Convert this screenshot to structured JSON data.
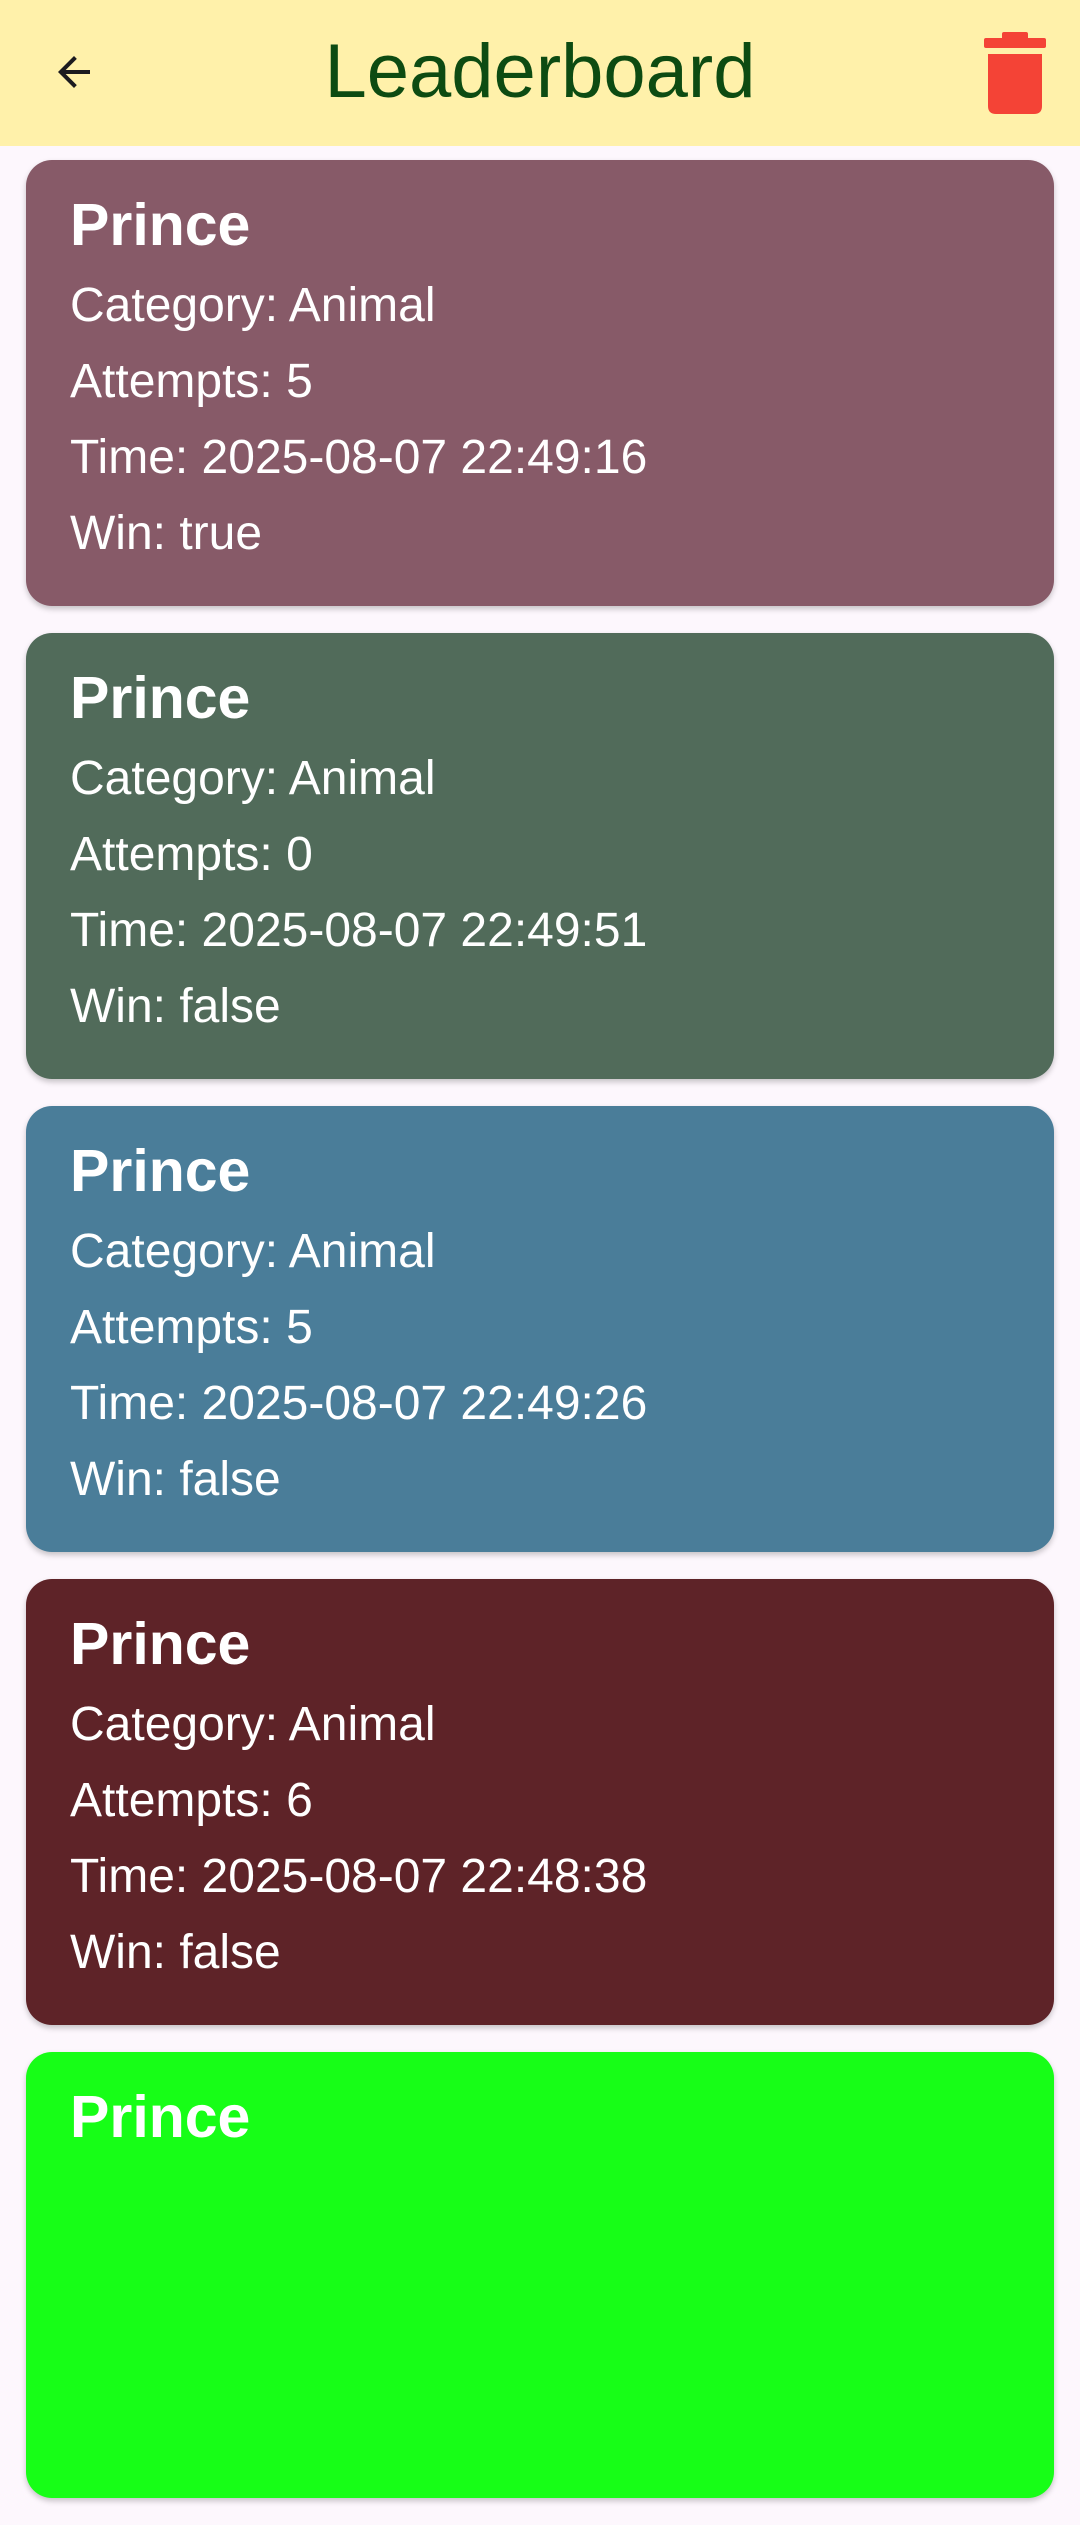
{
  "app_bar": {
    "title": "Leaderboard",
    "title_color": "#0d4b12",
    "background": "#fff1aa",
    "back_icon": "arrow-left-icon",
    "delete_icon": "trash-icon",
    "delete_color": "#f44336"
  },
  "entries": [
    {
      "name": "Prince",
      "category": "Category: Animal",
      "attempts": "Attempts: 5",
      "time": "Time: 2025-08-07 22:49:16",
      "win": "Win: true",
      "color": "#875a68"
    },
    {
      "name": "Prince",
      "category": "Category: Animal",
      "attempts": "Attempts: 0",
      "time": "Time: 2025-08-07 22:49:51",
      "win": "Win: false",
      "color": "#516b5a"
    },
    {
      "name": "Prince",
      "category": "Category: Animal",
      "attempts": "Attempts: 5",
      "time": "Time: 2025-08-07 22:49:26",
      "win": "Win: false",
      "color": "#4a7d99"
    },
    {
      "name": "Prince",
      "category": "Category: Animal",
      "attempts": "Attempts: 6",
      "time": "Time: 2025-08-07 22:48:38",
      "win": "Win: false",
      "color": "#5e2328"
    },
    {
      "name": "Prince",
      "category": "",
      "attempts": "",
      "time": "",
      "win": "",
      "color": "#17fe17"
    }
  ]
}
